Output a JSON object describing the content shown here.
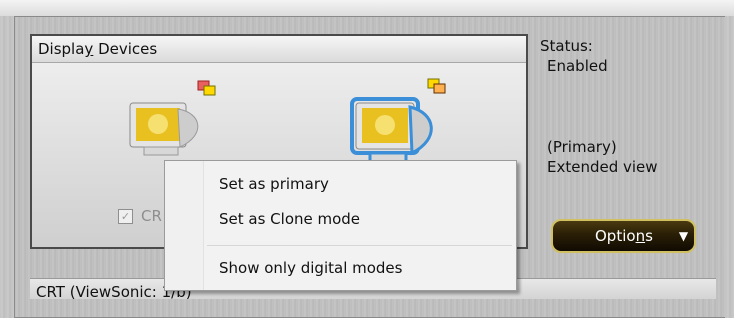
{
  "group": {
    "title_prefix": "Displa",
    "title_accel": "y",
    "title_suffix": " Devices"
  },
  "devices": [
    {
      "name": "monitor-1",
      "checkbox_label": "CR",
      "checked": true
    },
    {
      "name": "monitor-2",
      "selected": true
    }
  ],
  "status": {
    "label": "Status:",
    "value": "Enabled",
    "primary": "(Primary)",
    "mode": "Extended view"
  },
  "options": {
    "label_prefix": "Optio",
    "label_accel": "n",
    "label_suffix": "s"
  },
  "bottom": {
    "label": "CRT (ViewSonic: 1/b)"
  },
  "context_menu": {
    "items": [
      {
        "label": "Set as primary"
      },
      {
        "label": "Set as Clone mode"
      },
      {
        "label": "Show only digital modes"
      }
    ]
  },
  "colors": {
    "accent": "#3a8fd8",
    "button_bg": "#2a1f06",
    "button_border": "#d0c060",
    "monitor_screen": "#e8c020"
  }
}
